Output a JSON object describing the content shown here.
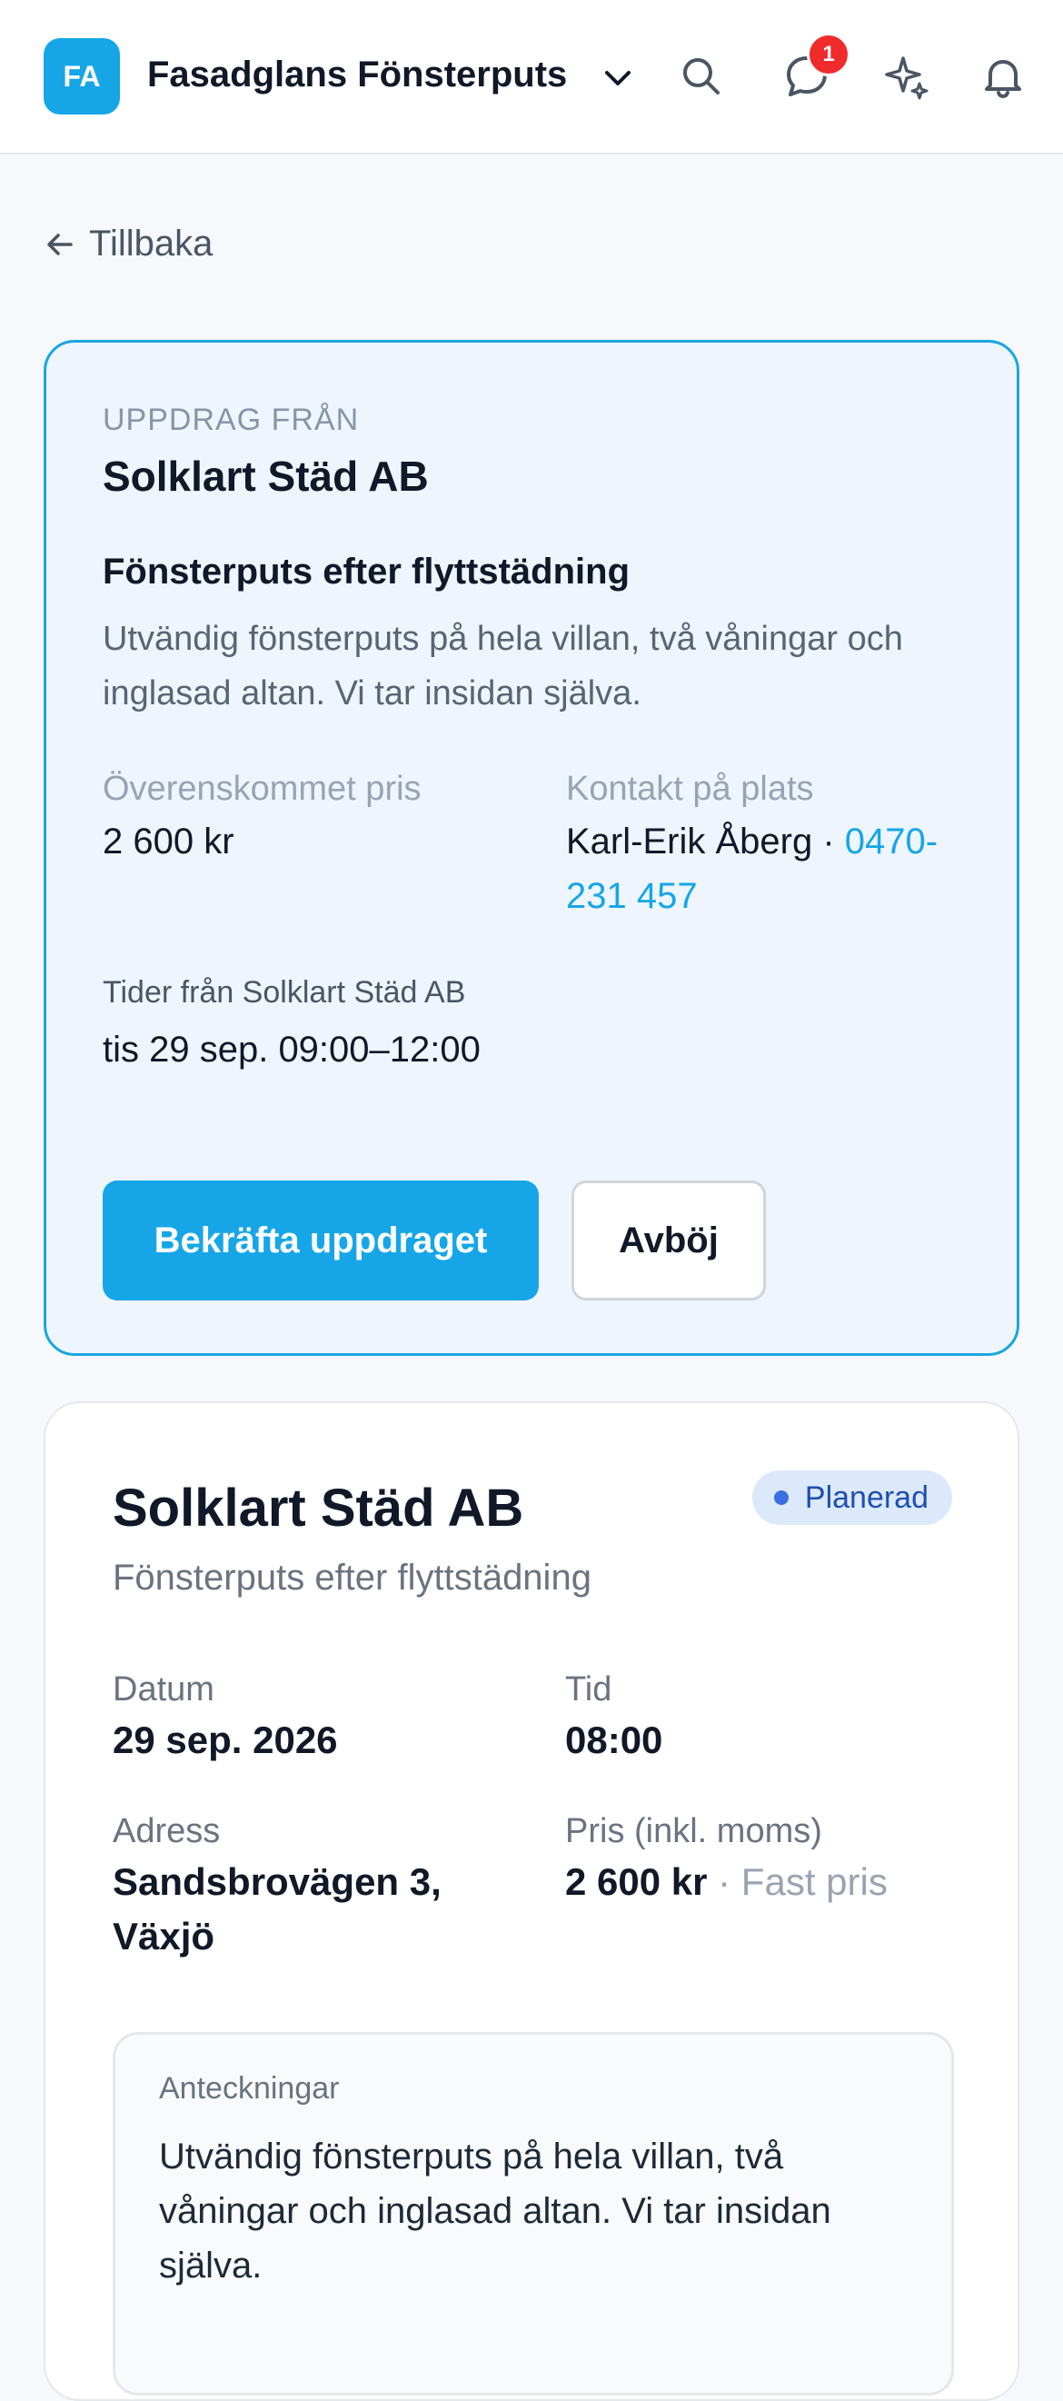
{
  "header": {
    "avatar_initials": "FA",
    "org_name": "Fasadglans Fönsterputs",
    "notification_count": "1",
    "icons": [
      "chevron-down-icon",
      "search-icon",
      "chat-icon",
      "sparkle-icon",
      "bell-icon"
    ]
  },
  "nav": {
    "back_label": "Tillbaka"
  },
  "assignment": {
    "eyebrow": "UPPDRAG FRÅN",
    "company": "Solklart Städ AB",
    "title": "Fönsterputs efter flyttstädning",
    "description": "Utvändig fönsterputs på hela villan, två våningar och inglasad altan. Vi tar insidan själva.",
    "price_label": "Överenskommet pris",
    "price_value": "2 600 kr",
    "contact_label": "Kontakt på plats",
    "contact_name": "Karl-Erik Åberg",
    "contact_separator": " · ",
    "contact_phone": "0470-231 457",
    "times_label": "Tider från Solklart Städ AB",
    "times_value": "tis 29 sep. 09:00–12:00",
    "confirm_label": "Bekräfta uppdraget",
    "decline_label": "Avböj"
  },
  "booking": {
    "company": "Solklart Städ AB",
    "status": "Planerad",
    "subtitle": "Fönsterputs efter flyttstädning",
    "date_label": "Datum",
    "date_value": "29 sep. 2026",
    "time_label": "Tid",
    "time_value": "08:00",
    "address_label": "Adress",
    "address_value": "Sandsbrovägen 3, Växjö",
    "price_label": "Pris (inkl. moms)",
    "price_value": "2 600 kr",
    "price_note": " · Fast pris",
    "notes_label": "Anteckningar",
    "notes_value": "Utvändig fönsterputs på hela villan, två våningar och inglasad altan. Vi tar insidan själva."
  },
  "colors": {
    "accent": "#16a6e8",
    "badge": "#ef2b2b",
    "status_bg": "#dbe9fb",
    "status_text": "#1f4fb3"
  }
}
